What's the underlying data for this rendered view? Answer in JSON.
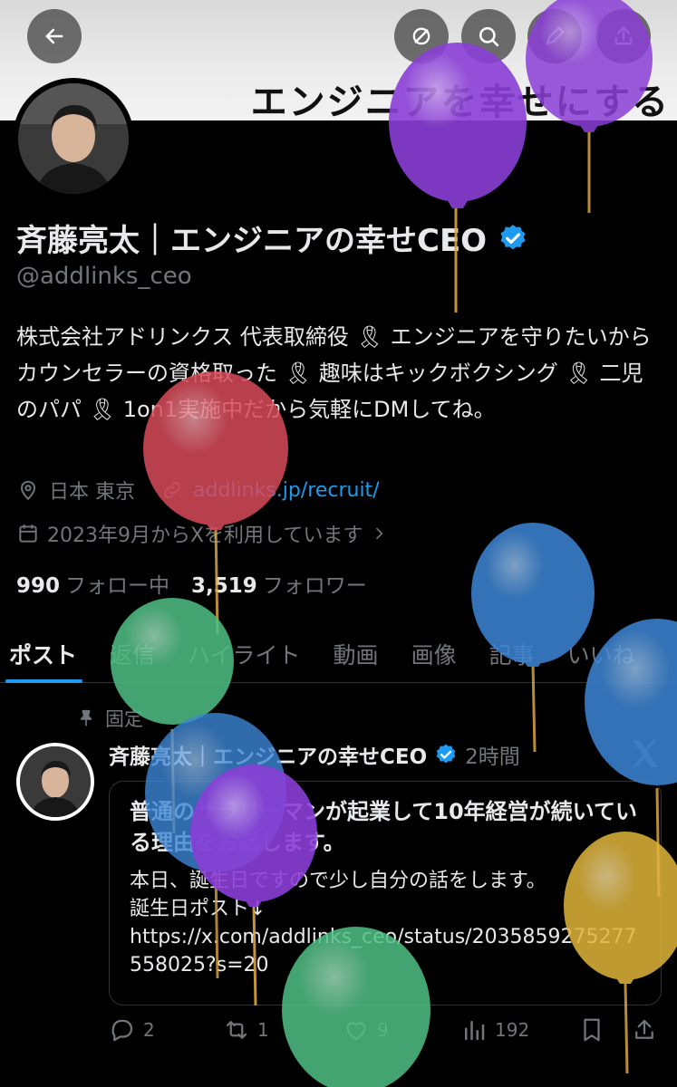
{
  "banner": {
    "text": "エンジニアを幸せにする"
  },
  "profile": {
    "display_name": "斉藤亮太｜エンジニアの幸せCEO",
    "handle": "@addlinks_ceo",
    "bio": "株式会社アドリンクス 代表取締役 🎗 エンジニアを守りたいからカウンセラーの資格取った 🎗 趣味はキックボクシング 🎗 二児のパパ 🎗 1on1実施中だから気軽にDMしてね。",
    "location": "日本 東京",
    "url": "addlinks.jp/recruit/",
    "joined": "2023年9月からXを利用しています",
    "following_count": "990",
    "following_label": "フォロー中",
    "followers_count": "3,519",
    "followers_label": "フォロワー"
  },
  "tabs": [
    {
      "label": "ポスト"
    },
    {
      "label": "返信"
    },
    {
      "label": "ハイライト"
    },
    {
      "label": "動画"
    },
    {
      "label": "画像"
    },
    {
      "label": "記事"
    },
    {
      "label": "いいね"
    }
  ],
  "post": {
    "pinned_label": "固定",
    "author": "斉藤亮太｜エンジニアの幸せCEO",
    "time": "2時間",
    "card_title": "普通のサラリーマンが起業して10年経営が続いている理由をお話します。",
    "card_line1": "本日、誕生日ですので少し自分の話をします。",
    "card_line2": "誕生日ポスト↓",
    "card_line3": "https://x.com/addlinks_ceo/status/2035859275277558025?s=20",
    "replies": "2",
    "reposts": "1",
    "likes": "9",
    "views": "192"
  },
  "colors": {
    "accent": "#1d9bf0",
    "muted": "#71767b",
    "text": "#e7e9ea",
    "border": "#2f3336"
  }
}
